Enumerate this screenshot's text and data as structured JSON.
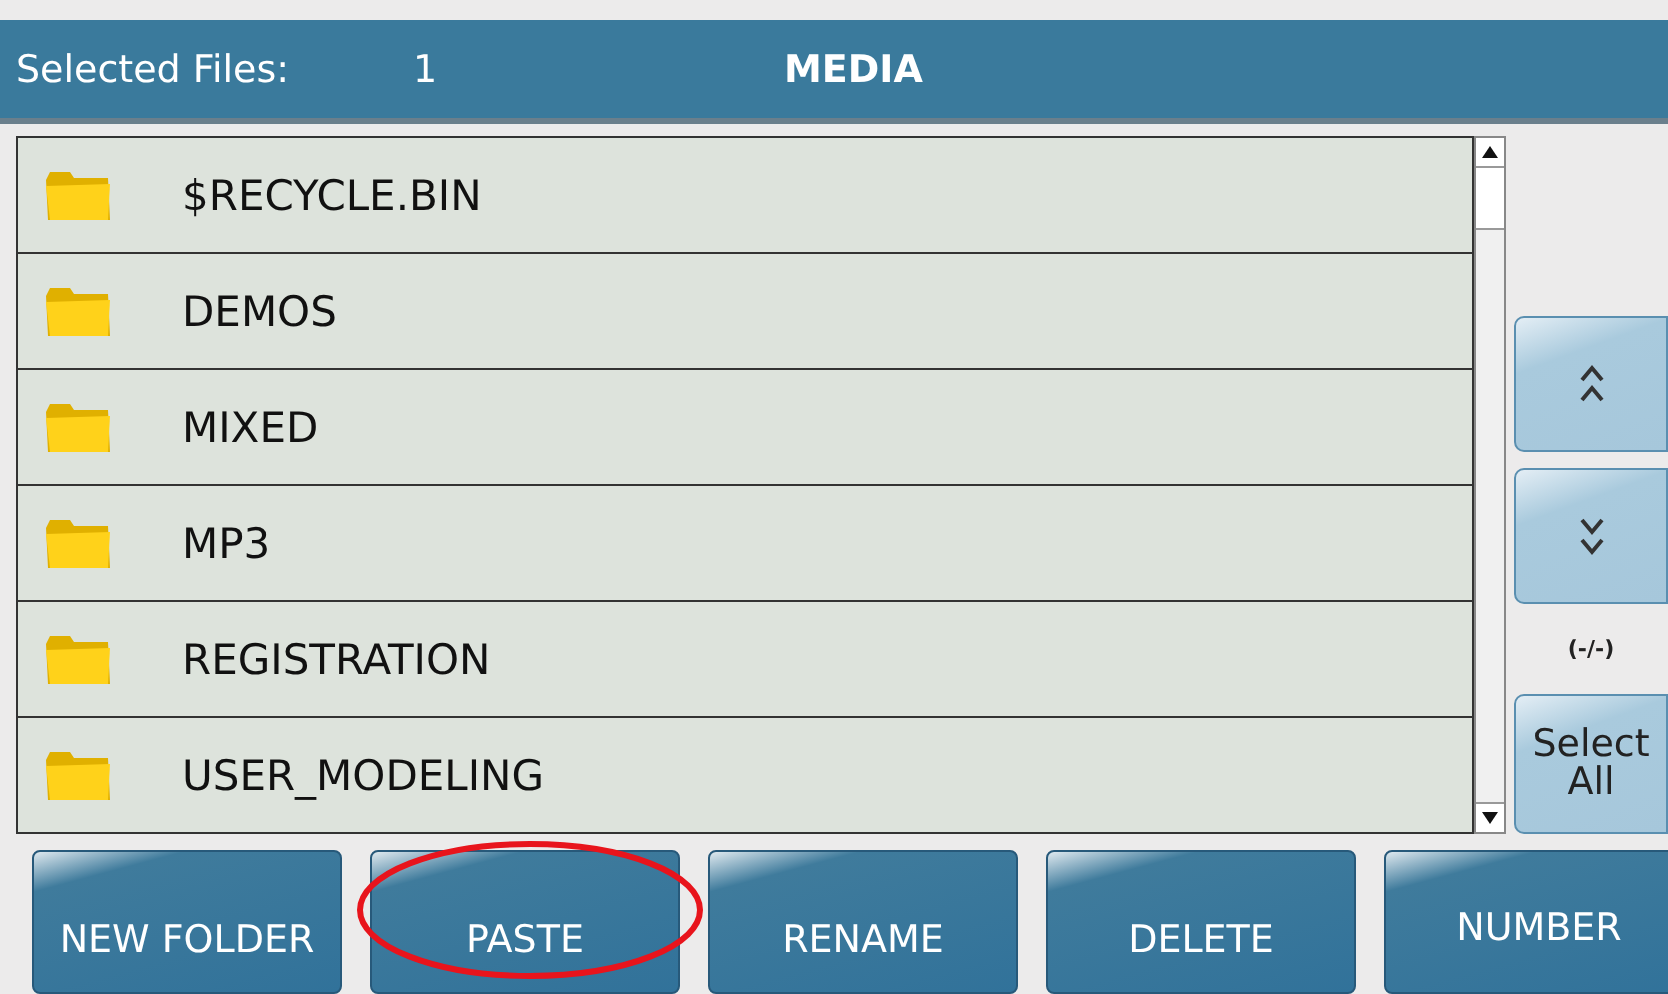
{
  "header": {
    "selected_label": "Selected Files:",
    "selected_count": "1",
    "title": "MEDIA"
  },
  "files": [
    {
      "name": "$RECYCLE.BIN"
    },
    {
      "name": "DEMOS"
    },
    {
      "name": "MIXED"
    },
    {
      "name": "MP3"
    },
    {
      "name": "REGISTRATION"
    },
    {
      "name": "USER_MODELING"
    }
  ],
  "side": {
    "page_indicator": "(-/-)",
    "select_all": "Select All"
  },
  "buttons": [
    {
      "label": "NEW FOLDER",
      "circled": false
    },
    {
      "label": "PASTE",
      "circled": true
    },
    {
      "label": "RENAME",
      "circled": false
    },
    {
      "label": "DELETE",
      "circled": false
    },
    {
      "label": "NUMBER",
      "circled": false
    }
  ]
}
